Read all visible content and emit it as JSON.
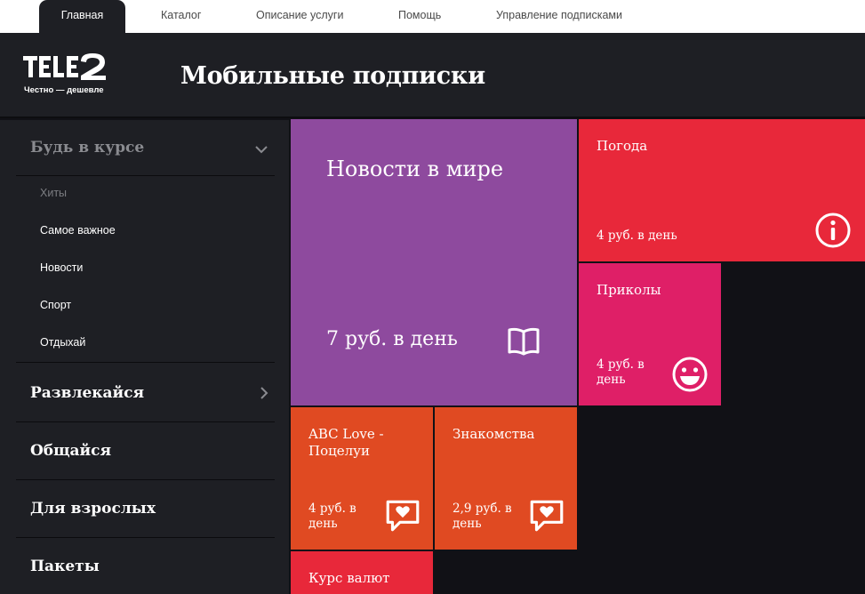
{
  "nav": {
    "tabs": [
      "Главная",
      "Каталог",
      "Описание услуги",
      "Помощь",
      "Управление подписками"
    ]
  },
  "header": {
    "logo_text": "TELE2",
    "logo_tagline": "Честно — дешевле",
    "title": "Мобильные подписки"
  },
  "sidebar": {
    "groups": [
      {
        "label": "Будь в курсе",
        "expanded": true,
        "chevron": "chevron-down-icon"
      },
      {
        "label": "Развлекайся",
        "chevron": "chevron-right-icon"
      },
      {
        "label": "Общайся"
      },
      {
        "label": "Для взрослых"
      },
      {
        "label": "Пакеты"
      }
    ],
    "subitems": [
      "Хиты",
      "Самое важное",
      "Новости",
      "Спорт",
      "Отдыхай"
    ]
  },
  "tiles": [
    {
      "title": "Новости в мире",
      "price": "7 руб. в день",
      "color": "#8e4a9e",
      "icon": "book-icon"
    },
    {
      "title": "Погода",
      "price": "4 руб. в день",
      "color": "#e8283a",
      "icon": "info-icon"
    },
    {
      "title": "Приколы",
      "price": "4 руб. в день",
      "color": "#df1f67",
      "icon": "smiley-icon"
    },
    {
      "title": "ABC Love - Поцелуи",
      "price": "4 руб. в день",
      "color": "#e04a22",
      "icon": "heart-chat-icon"
    },
    {
      "title": "Знакомства",
      "price": "2,9 руб. в день",
      "color": "#e04a22",
      "icon": "heart-chat-icon"
    },
    {
      "title": "Курс валют",
      "color": "#e8283a"
    }
  ],
  "colors": {
    "header_bg": "#1e1f24",
    "page_bg": "#111116"
  }
}
